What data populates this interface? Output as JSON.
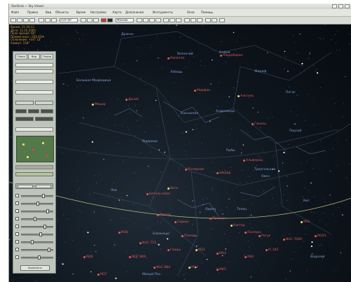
{
  "window": {
    "title": "StarDesk — Sky Viewer"
  },
  "menu": [
    "Файл",
    "Правка",
    "Вид",
    "Объекты",
    "Время",
    "Настройки",
    "Карта",
    "Дополнения",
    "Инструменты",
    "Окна",
    "Помощь"
  ],
  "toolbar": {
    "zoom_value": "FOV 60°",
    "location_value": "Москва"
  },
  "info_lines": [
    "Время: 21:34:12",
    "Дата: 12.10.2005",
    "Поле зрения: 60°",
    "Прямое восх.: 03h 42m",
    "Склонение: +34° 12'",
    "Азимут: 118°"
  ],
  "panel": {
    "tabs": [
      "Поиск",
      "Вид",
      "Опции"
    ],
    "section_tabs": [
      "Слои",
      "Фильтр"
    ],
    "apply_button": "Применить"
  },
  "constellations": [
    {
      "name": "Дракон",
      "tone": "b"
    },
    {
      "name": "Кефей",
      "tone": "b"
    },
    {
      "name": "Большая Медведица",
      "tone": "b"
    },
    {
      "name": "Лебедь",
      "tone": "b"
    },
    {
      "name": "Кассиопея",
      "tone": "b"
    },
    {
      "name": "Андромеда",
      "tone": "b"
    },
    {
      "name": "Персей",
      "tone": "b"
    },
    {
      "name": "Рыбы",
      "tone": "b"
    },
    {
      "name": "Треугольник",
      "tone": "b"
    },
    {
      "name": "Пегас",
      "tone": "b"
    },
    {
      "name": "Ящерица",
      "tone": "b"
    },
    {
      "name": "Лев",
      "tone": "b"
    },
    {
      "name": "Орион",
      "tone": "b"
    },
    {
      "name": "Телец",
      "tone": "b"
    },
    {
      "name": "Овен",
      "tone": "b"
    },
    {
      "name": "Кит",
      "tone": "b"
    },
    {
      "name": "Водолей",
      "tone": "b"
    },
    {
      "name": "Близнецы",
      "tone": "b"
    },
    {
      "name": "Рак",
      "tone": "b"
    },
    {
      "name": "Малый Пес",
      "tone": "b"
    },
    {
      "name": "Возничий",
      "tone": "b"
    },
    {
      "name": "Жираф",
      "tone": "b"
    },
    {
      "name": "Рысь",
      "tone": "b"
    }
  ],
  "objects": [
    "Мицар",
    "Денеб",
    "Капелла",
    "Альдебаран",
    "Мирфак",
    "Альголь",
    "Гамаль",
    "Альферац",
    "Шедар",
    "Полярная",
    "Вега",
    "Бетельгейзе",
    "Ригель",
    "Сириус",
    "Процион",
    "Кастор",
    "Поллукс",
    "Регул",
    "Плеяды",
    "Гиады",
    "M31",
    "M33",
    "NGC 752",
    "NGC 869",
    "NGC 884",
    "M34",
    "M45",
    "M42",
    "IC 342",
    "NGC 7000",
    "M52",
    "M103",
    "M36",
    "M37",
    "M38"
  ]
}
